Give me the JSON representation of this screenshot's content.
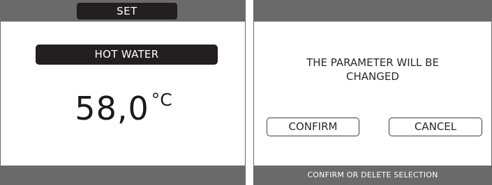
{
  "left_panel": {
    "mode_label": "SET",
    "parameter_name": "HOT WATER",
    "value": "58,0",
    "unit": "°C"
  },
  "right_panel": {
    "message_line1": "THE PARAMETER WILL BE",
    "message_line2": "CHANGED",
    "confirm_label": "CONFIRM",
    "cancel_label": "CANCEL",
    "footer_text": "CONFIRM OR DELETE SELECTION"
  },
  "colors": {
    "bar": "#6a6a6a",
    "pill": "#231f20",
    "background": "#ffffff",
    "text": "#1d1d1d"
  }
}
